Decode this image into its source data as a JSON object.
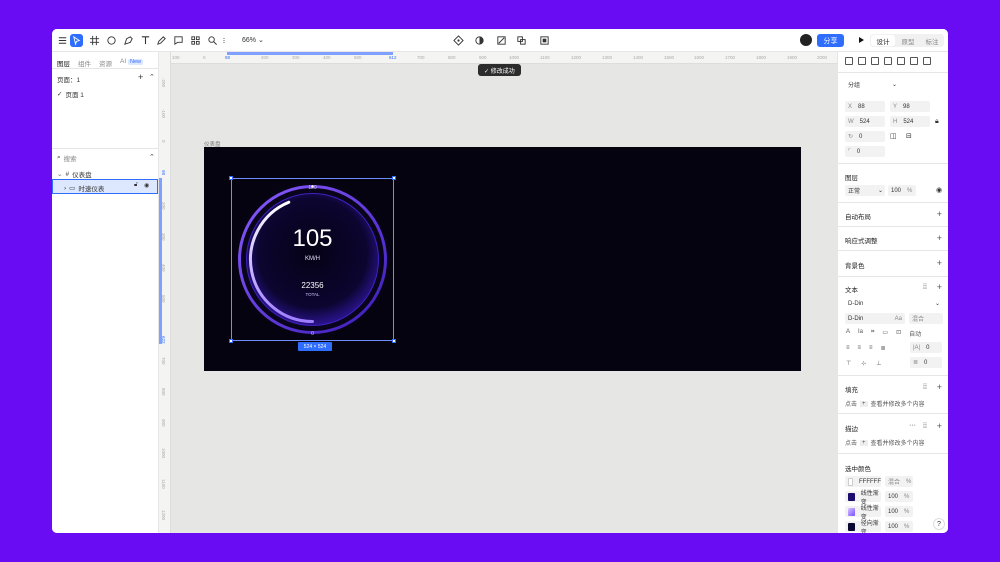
{
  "toolbar": {
    "zoom": "66%",
    "share_label": "分享",
    "mode_tabs": [
      "设计",
      "原型",
      "标注"
    ]
  },
  "left_panel": {
    "tabs": [
      "图层",
      "组件",
      "资源",
      "AI"
    ],
    "new_badge": "New",
    "pages_label": "页面：1",
    "page_item": "页面 1",
    "search_placeholder": "搜索",
    "layers": [
      {
        "label": "仪表盘"
      },
      {
        "label": "时速仪表"
      }
    ]
  },
  "canvas": {
    "h_ruler": [
      "100",
      "0",
      "88",
      "200",
      "300",
      "400",
      "500",
      "612",
      "700",
      "800",
      "900",
      "1000",
      "1100",
      "1200",
      "1300",
      "1400",
      "1500",
      "1600",
      "1700",
      "1800",
      "1900",
      "2000"
    ],
    "v_ruler": [
      "-200",
      "-100",
      "0",
      "98",
      "200",
      "300",
      "400",
      "500",
      "622",
      "700",
      "800",
      "900",
      "1000",
      "1100",
      "1200"
    ],
    "frame_label": "仪表盘",
    "toast": "✓ 修改成功",
    "size_badge": "524 × 524",
    "gauge": {
      "max_label": "120",
      "min_label": "0",
      "speed": "105",
      "unit": "KM/H",
      "total_value": "22356",
      "total_label": "TOTAL",
      "progress": 0.875,
      "accent": "#6b34ff"
    }
  },
  "right_panel": {
    "group_label": "分组",
    "x_label": "X",
    "x": "88",
    "y_label": "Y",
    "y": "98",
    "w_label": "W",
    "w": "524",
    "h_label": "H",
    "h": "524",
    "rotation": "0",
    "radius": "0",
    "layer_title": "图层",
    "blend_mode": "正常",
    "opacity": "100",
    "percent": "%",
    "auto_layout": "自动布局",
    "responsive": "响应式调整",
    "background": "背景色",
    "text_title": "文本",
    "font_family": "D-Din",
    "font_style": "D-Din",
    "font_size_label": "Aa",
    "mixed": "混合",
    "auto": "自动",
    "letter_spacing": "0",
    "paragraph_spacing": "0",
    "fill_title": "填充",
    "fill_hint": "点击",
    "fill_hint2": "查看并修改多个内容",
    "stroke_title": "描边",
    "stroke_hint": "点击",
    "stroke_hint2": "查看并修改多个内容",
    "selected_colors_title": "选中颜色",
    "colors": [
      {
        "name": "FFFFFF",
        "value": "混合",
        "swatch": "#ffffff"
      },
      {
        "name": "线性渐变",
        "value": "100",
        "swatch": "#1b0d6e"
      },
      {
        "name": "线性渐变",
        "value": "100",
        "swatch": "#b79cff"
      },
      {
        "name": "径向渐变",
        "value": "100",
        "swatch": "#0a0830"
      }
    ],
    "help": "?"
  }
}
